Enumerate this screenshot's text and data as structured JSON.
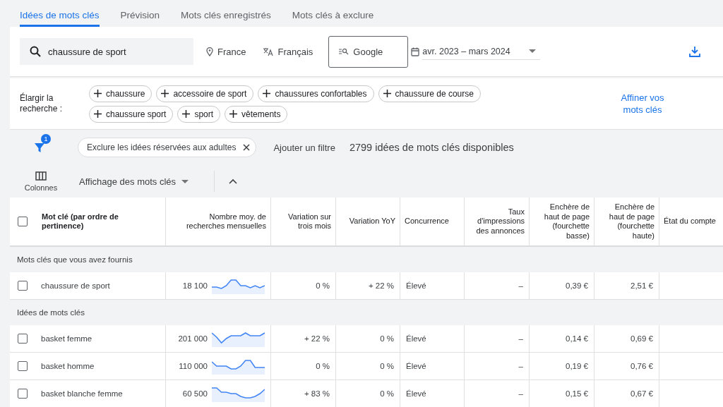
{
  "tabs": [
    {
      "label": "Idées de mots clés",
      "selected": true
    },
    {
      "label": "Prévision",
      "selected": false
    },
    {
      "label": "Mots clés enregistrés",
      "selected": false
    },
    {
      "label": "Mots clés à exclure",
      "selected": false
    }
  ],
  "search": {
    "value": "chaussure de sport"
  },
  "location": "France",
  "language": "Français",
  "network": "Google",
  "date_range": "avr. 2023 – mars 2024",
  "broaden": {
    "label": "Élargir la recherche :",
    "chips": [
      "chaussure",
      "accessoire de sport",
      "chaussures confortables",
      "chaussure de course",
      "chaussure sport",
      "sport",
      "vêtements"
    ]
  },
  "refine_link": "Affiner vos mots clés",
  "filters": {
    "badge": "1",
    "chip": "Exclure les idées réservées aux adultes",
    "add": "Ajouter un filtre",
    "count": "2799 idées de mots clés disponibles"
  },
  "columns_button": "Colonnes",
  "view_dropdown": "Affichage des mots clés",
  "table": {
    "select_all_checked": false,
    "columns": [
      "Mot clé (par ordre de pertinence)",
      "Nombre moy. de recherches mensuelles",
      "Variation sur trois mois",
      "Variation YoY",
      "Concurrence",
      "Taux d'impressions des annonces",
      "Enchère de haut de page (fourchette basse)",
      "Enchère de haut de page (fourchette haute)",
      "État du compte"
    ],
    "groups": [
      {
        "title": "Mots clés que vous avez fournis",
        "rows": [
          {
            "checked": false,
            "keyword": "chaussure de sport",
            "searches": "18 100",
            "three_month": "0 %",
            "yoy": "+ 22 %",
            "competition": "Élevé",
            "impression_share": "–",
            "bid_low": "0,39 €",
            "bid_high": "2,51 €"
          }
        ]
      },
      {
        "title": "Idées de mots clés",
        "rows": [
          {
            "checked": false,
            "keyword": "basket femme",
            "searches": "201 000",
            "three_month": "+ 22 %",
            "yoy": "0 %",
            "competition": "Élevé",
            "impression_share": "–",
            "bid_low": "0,14 €",
            "bid_high": "0,69 €"
          },
          {
            "checked": false,
            "keyword": "basket homme",
            "searches": "110 000",
            "three_month": "0 %",
            "yoy": "0 %",
            "competition": "Élevé",
            "impression_share": "–",
            "bid_low": "0,19 €",
            "bid_high": "0,76 €"
          },
          {
            "checked": false,
            "keyword": "basket blanche femme",
            "searches": "60 500",
            "three_month": "+ 83 %",
            "yoy": "0 %",
            "competition": "Élevé",
            "impression_share": "–",
            "bid_low": "0,15 €",
            "bid_high": "0,67 €"
          }
        ]
      }
    ]
  }
}
